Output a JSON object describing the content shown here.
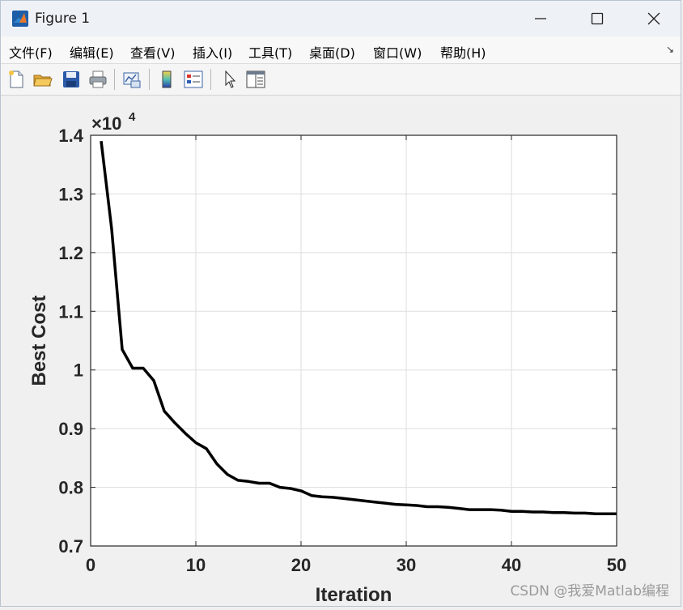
{
  "window": {
    "title": "Figure 1",
    "controls": {
      "minimize": "minimize",
      "maximize": "maximize",
      "close": "close"
    }
  },
  "menu": {
    "items": [
      "文件(F)",
      "编辑(E)",
      "查看(V)",
      "插入(I)",
      "工具(T)",
      "桌面(D)",
      "窗口(W)",
      "帮助(H)"
    ],
    "corner_glyph": "↘"
  },
  "toolbar": {
    "buttons": [
      "new-figure-icon",
      "open-file-icon",
      "save-icon",
      "print-icon",
      "link-plot-icon",
      "colorbar-icon",
      "legend-icon",
      "pointer-icon",
      "property-editor-icon"
    ]
  },
  "chart_data": {
    "type": "line",
    "xlabel": "Iteration",
    "ylabel": "Best Cost",
    "exponent_label": "×10",
    "exponent_power": "4",
    "xlim": [
      0,
      50
    ],
    "ylim": [
      0.7,
      1.4
    ],
    "xticks": [
      "0",
      "10",
      "20",
      "30",
      "40",
      "50"
    ],
    "yticks": [
      "0.7",
      "0.8",
      "0.9",
      "1",
      "1.1",
      "1.2",
      "1.3",
      "1.4"
    ],
    "grid": true,
    "line_color": "#000000",
    "series": [
      {
        "x": [
          1,
          2,
          3,
          4,
          5,
          6,
          7,
          8,
          9,
          10,
          11,
          12,
          13,
          14,
          15,
          16,
          17,
          18,
          19,
          20,
          21,
          22,
          23,
          24,
          25,
          26,
          27,
          28,
          29,
          30,
          31,
          32,
          33,
          34,
          35,
          36,
          37,
          38,
          39,
          40,
          41,
          42,
          43,
          44,
          45,
          46,
          47,
          48,
          49,
          50
        ],
        "values": [
          1.39,
          1.24,
          1.035,
          1.003,
          1.003,
          0.982,
          0.93,
          0.91,
          0.892,
          0.876,
          0.866,
          0.84,
          0.822,
          0.812,
          0.81,
          0.807,
          0.807,
          0.8,
          0.798,
          0.794,
          0.786,
          0.784,
          0.783,
          0.781,
          0.779,
          0.777,
          0.775,
          0.773,
          0.771,
          0.77,
          0.769,
          0.767,
          0.767,
          0.766,
          0.764,
          0.762,
          0.762,
          0.762,
          0.761,
          0.759,
          0.759,
          0.758,
          0.758,
          0.757,
          0.757,
          0.756,
          0.756,
          0.755,
          0.755,
          0.755
        ]
      }
    ]
  },
  "watermark": "CSDN @我爱Matlab编程"
}
